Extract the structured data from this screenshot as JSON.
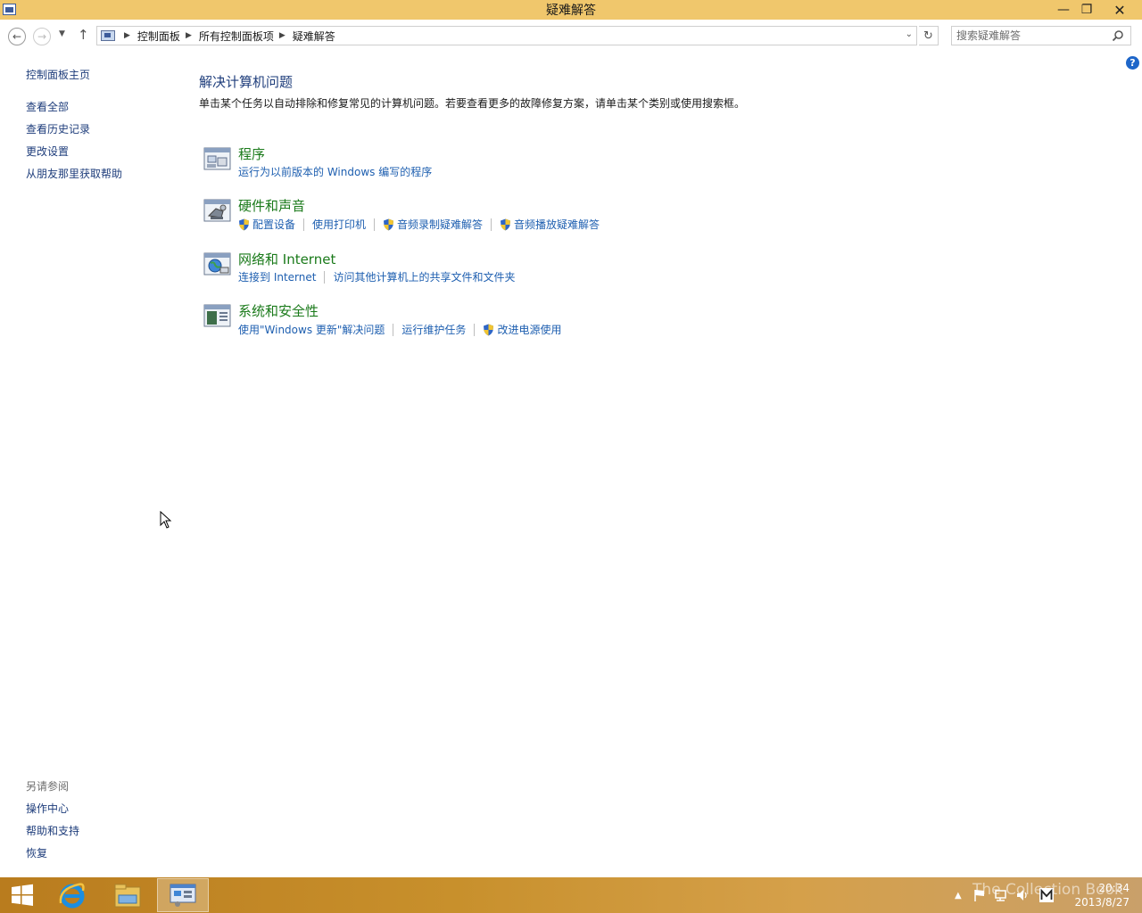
{
  "window": {
    "title": "疑难解答",
    "controls": {
      "minimize": "—",
      "maximize": "❐",
      "close": "✕"
    }
  },
  "address": {
    "crumbs": [
      "控制面板",
      "所有控制面板项",
      "疑难解答"
    ],
    "search_placeholder": "搜索疑难解答"
  },
  "leftnav": {
    "home": "控制面板主页",
    "items": [
      "查看全部",
      "查看历史记录",
      "更改设置",
      "从朋友那里获取帮助"
    ],
    "see_also_label": "另请参阅",
    "see_also": [
      "操作中心",
      "帮助和支持",
      "恢复"
    ]
  },
  "main": {
    "title": "解决计算机问题",
    "description": "单击某个任务以自动排除和修复常见的计算机问题。若要查看更多的故障修复方案，请单击某个类别或使用搜索框。",
    "categories": [
      {
        "title": "程序",
        "icon": "programs-icon",
        "links": [
          {
            "label": "运行为以前版本的 Windows 编写的程序",
            "shield": false
          }
        ]
      },
      {
        "title": "硬件和声音",
        "icon": "hardware-sound-icon",
        "links": [
          {
            "label": "配置设备",
            "shield": true
          },
          {
            "label": "使用打印机",
            "shield": false
          },
          {
            "label": "音频录制疑难解答",
            "shield": true
          },
          {
            "label": "音频播放疑难解答",
            "shield": true
          }
        ]
      },
      {
        "title": "网络和 Internet",
        "icon": "network-icon",
        "links": [
          {
            "label": "连接到 Internet",
            "shield": false
          },
          {
            "label": "访问其他计算机上的共享文件和文件夹",
            "shield": false
          }
        ]
      },
      {
        "title": "系统和安全性",
        "icon": "system-security-icon",
        "links": [
          {
            "label": "使用\"Windows 更新\"解决问题",
            "shield": false
          },
          {
            "label": "运行维护任务",
            "shield": false
          },
          {
            "label": "改进电源使用",
            "shield": true
          }
        ]
      }
    ]
  },
  "taskbar": {
    "apps": [
      "start-icon",
      "internet-explorer-icon",
      "file-explorer-icon",
      "control-panel-icon"
    ],
    "clock_time": "20:34",
    "clock_date": "2013/8/27",
    "watermark": "The Collection Book"
  },
  "colors": {
    "titlebar": "#f0c76c",
    "link": "#1e5fb0",
    "category_title": "#1a7a1a",
    "nav_text": "#1e3d7b"
  }
}
